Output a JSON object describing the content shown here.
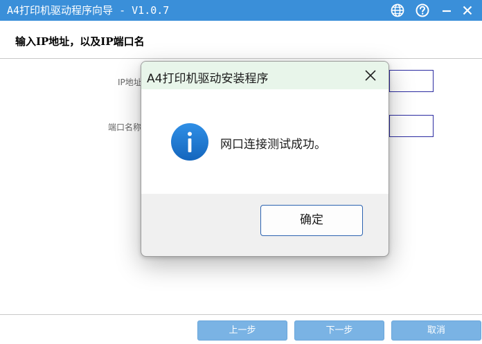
{
  "window": {
    "title": "A4打印机驱动程序向导 - V1.0.7",
    "accent_color": "#3a8fd9",
    "icons": [
      "globe-icon",
      "help-icon",
      "minimize-icon",
      "close-icon"
    ]
  },
  "wizard": {
    "header": "输入IP地址，以及IP端口名",
    "fields": [
      {
        "label": "IP地址",
        "value": ""
      },
      {
        "label": "端口名称",
        "value": ""
      }
    ],
    "buttons": {
      "prev": "上一步",
      "next": "下一步",
      "cancel": "取消"
    }
  },
  "dialog": {
    "title": "A4打印机驱动安装程序",
    "message": "网口连接测试成功。",
    "ok_label": "确定",
    "icon": "info-icon",
    "icon_color": "#1a73c8"
  }
}
